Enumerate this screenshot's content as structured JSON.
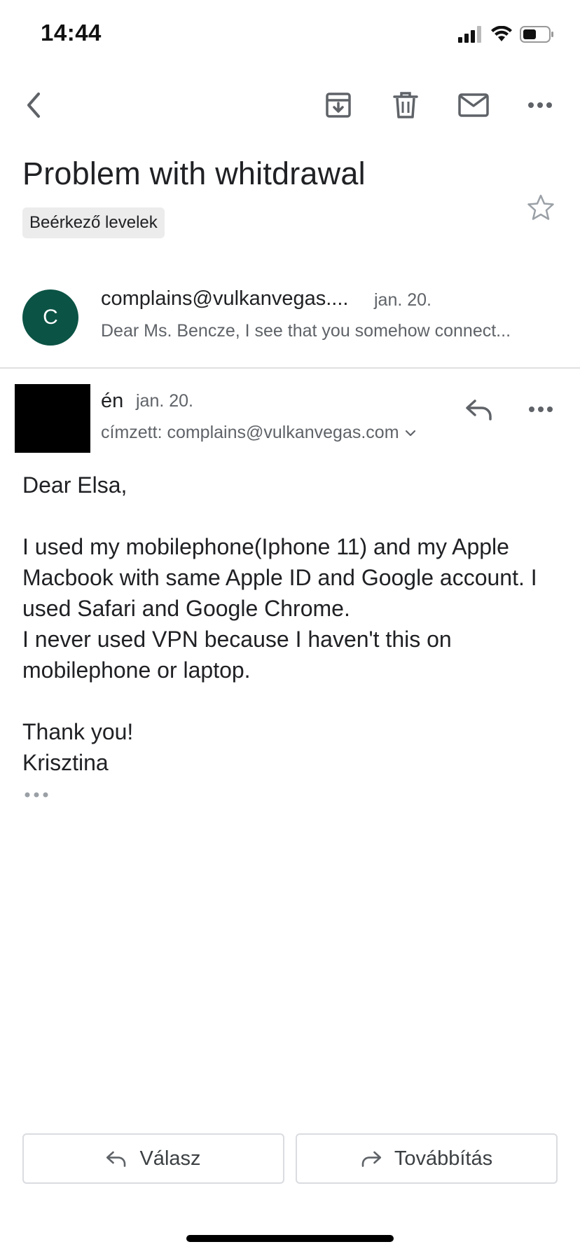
{
  "status_bar": {
    "time": "14:44"
  },
  "toolbar": {
    "back_icon": "chevron-left-icon",
    "archive_icon": "archive-icon",
    "delete_icon": "trash-icon",
    "mail_icon": "mail-unread-icon",
    "more_icon": "more-horizontal-icon"
  },
  "thread": {
    "subject": "Problem with whitdrawal",
    "label": "Beérkező levelek",
    "starred": false
  },
  "messages": [
    {
      "avatar_letter": "C",
      "avatar_color": "#0b5345",
      "sender": "complains@vulkanvegas....",
      "date": "jan. 20.",
      "snippet": "Dear Ms. Bencze, I see that you somehow connect..."
    },
    {
      "sender": "én",
      "date": "jan. 20.",
      "recipient": "címzett: complains@vulkanvegas.com",
      "body": {
        "greeting": "Dear Elsa,",
        "line1": "I used my mobilephone(Iphone 11) and my Apple Macbook with same Apple ID and Google account. I used Safari and Google Chrome.",
        "line2": "I never used VPN because I haven't this on mobilephone or laptop.",
        "closing1": "Thank you!",
        "closing2": "Krisztina"
      }
    }
  ],
  "actions": {
    "reply_label": "Válasz",
    "forward_label": "Továbbítás"
  }
}
